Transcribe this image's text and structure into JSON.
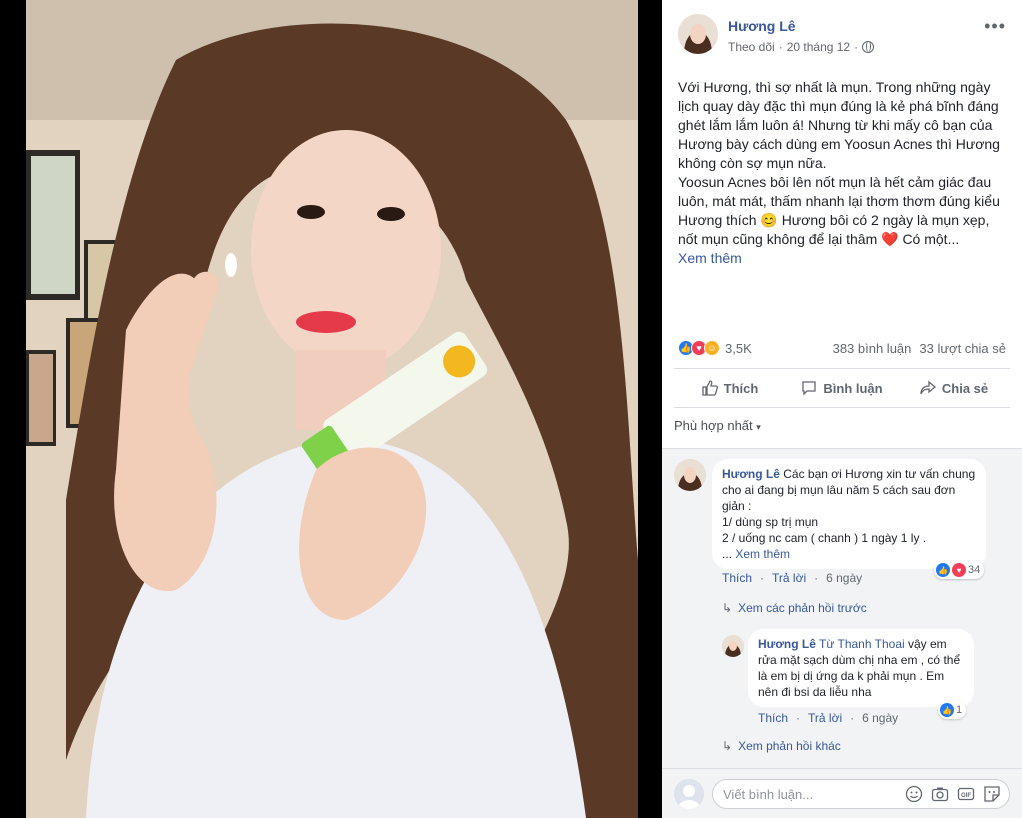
{
  "post": {
    "author": "Hương Lê",
    "follow": "Theo dõi",
    "separator": "·",
    "date": "20 tháng 12",
    "more_icon": "more-options-icon",
    "text": "Với Hương, thì sợ nhất là mụn. Trong những ngày lịch quay dày đặc thì mụn đúng là kẻ phá bĩnh đáng ghét lắm lắm luôn á! Nhưng từ khi mấy cô bạn của Hương bày cách dùng em Yoosun Acnes thì Hương không còn sợ mụn nữa.\nYoosun Acnes bôi lên nốt mụn là hết cảm giác đau luôn, mát mát, thấm nhanh lại thơm thơm đúng kiểu Hương thích 😊 Hương bôi có 2 ngày là mụn xẹp, nốt mụn cũng không để lại thâm ❤️ Có một...",
    "see_more": "Xem thêm"
  },
  "stats": {
    "reactions_count": "3,5K",
    "comments": "383 bình luận",
    "shares": "33 lượt chia sẻ"
  },
  "actions": {
    "like": "Thích",
    "comment": "Bình luận",
    "share": "Chia sẻ"
  },
  "sort": {
    "label": "Phù hợp nhất",
    "caret": "▾"
  },
  "comments": {
    "c1": {
      "name": "Hương Lê",
      "text": " Các bạn ơi Hương xin tư vấn chung cho ai đang bị mụn lâu năm 5 cách sau đơn giản :\n1/ dùng sp trị mụn\n2 / uống nc cam ( chanh ) 1 ngày 1 ly .",
      "ellipsis": "... ",
      "see_more": "Xem thêm",
      "like": "Thích",
      "reply": "Trả lời",
      "time": "6 ngày",
      "react_count": "34"
    },
    "view_prev": "Xem các phản hồi trước",
    "r1": {
      "name": "Hương Lê",
      "mention": "Từ Thanh Thoai",
      "text": " vậy em rửa mặt sạch dùm chị nha em , có thể là em bị dị ứng da k phải mụn . Em nên đi bsi da liễu nha",
      "like": "Thích",
      "reply": "Trả lời",
      "time": "6 ngày",
      "react_count": "1"
    },
    "view_more": "Xem phản hồi khác",
    "dot": "·"
  },
  "write": {
    "placeholder": "Viết bình luận..."
  },
  "colors": {
    "link": "#385898",
    "like": "#2078f4",
    "love": "#f33e58",
    "haha": "#f7b125"
  }
}
